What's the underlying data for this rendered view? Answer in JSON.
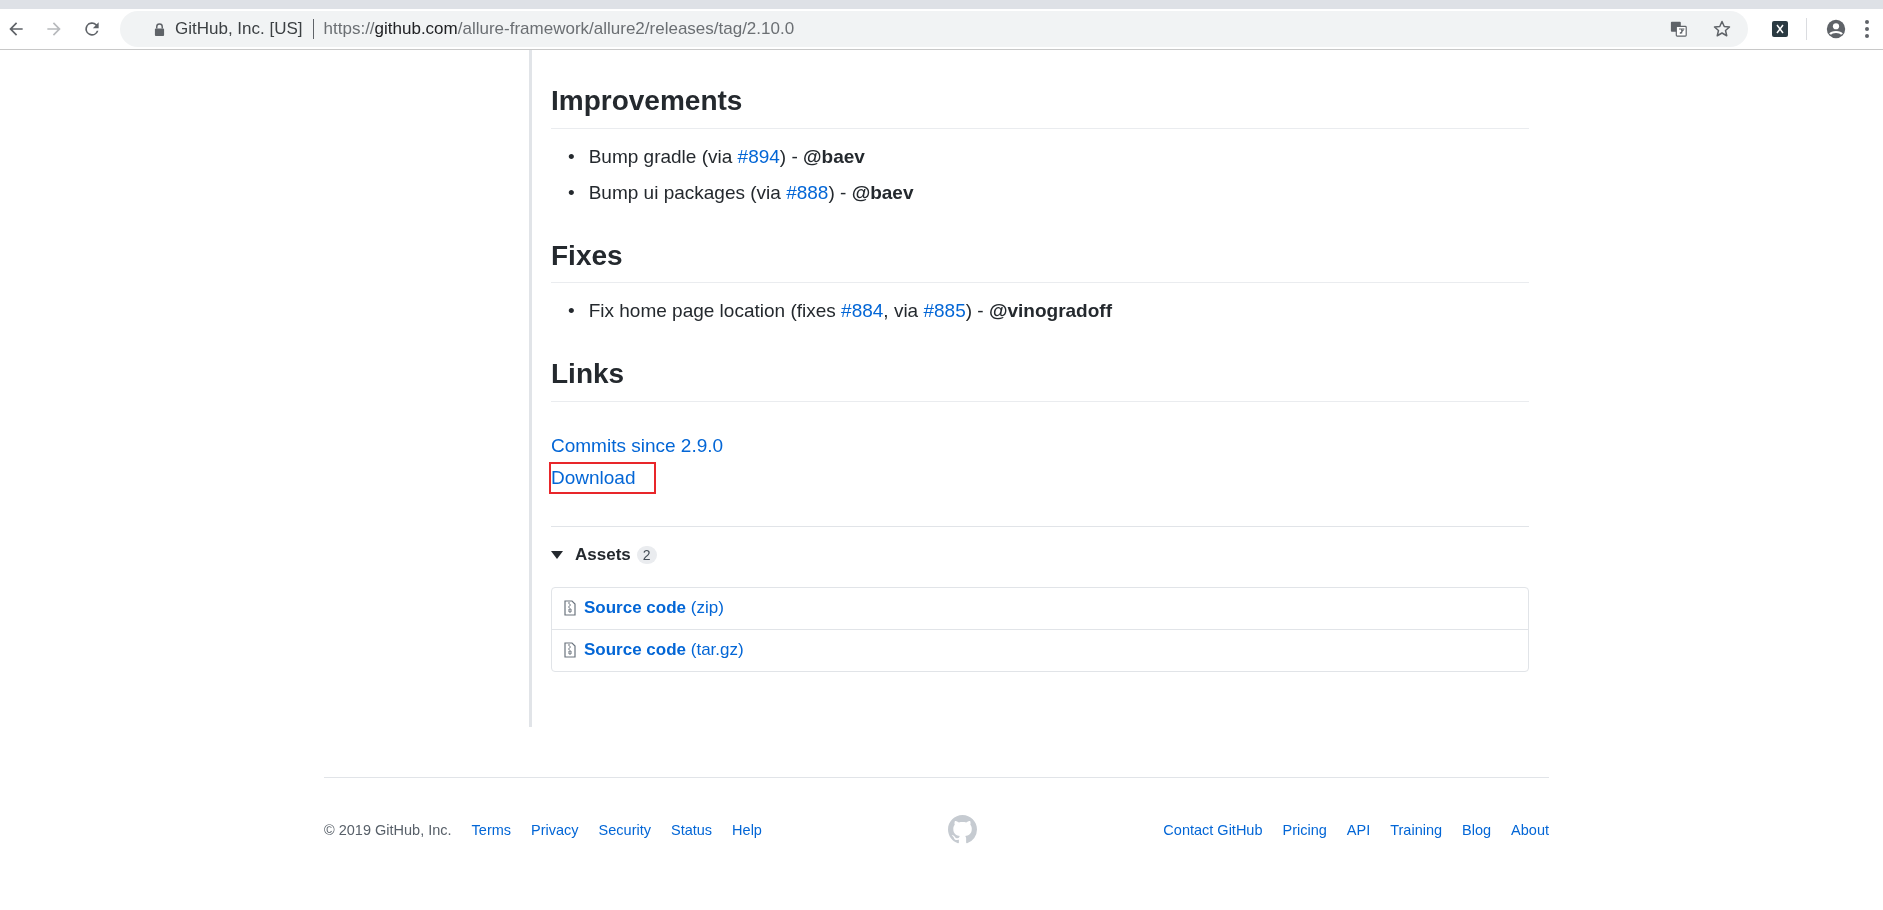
{
  "browser": {
    "site_label": "GitHub, Inc. [US]",
    "url_scheme": "https://",
    "url_host": "github.com",
    "url_path": "/allure-framework/allure2/releases/tag/2.10.0",
    "forward_disabled": true
  },
  "sections": [
    {
      "heading": "Improvements",
      "items": [
        {
          "marker": "•",
          "parts": [
            {
              "kind": "text",
              "text": "Bump gradle (via "
            },
            {
              "kind": "link",
              "text": "#894"
            },
            {
              "kind": "text",
              "text": ") - "
            },
            {
              "kind": "mention",
              "text": "@baev"
            }
          ]
        },
        {
          "marker": "•",
          "parts": [
            {
              "kind": "text",
              "text": "Bump ui packages (via "
            },
            {
              "kind": "link",
              "text": "#888"
            },
            {
              "kind": "text",
              "text": ") - "
            },
            {
              "kind": "mention",
              "text": "@baev"
            }
          ]
        }
      ]
    },
    {
      "heading": "Fixes",
      "items": [
        {
          "marker": "•",
          "parts": [
            {
              "kind": "text",
              "text": "Fix home page location (fixes "
            },
            {
              "kind": "link",
              "text": "#884"
            },
            {
              "kind": "text",
              "text": ", via "
            },
            {
              "kind": "link",
              "text": "#885"
            },
            {
              "kind": "text",
              "text": ") - "
            },
            {
              "kind": "mention",
              "text": "@vinogradoff"
            }
          ]
        }
      ]
    }
  ],
  "links": {
    "heading": "Links",
    "items": [
      {
        "label": "Commits since 2.9.0",
        "highlighted": false
      },
      {
        "label": "Download",
        "highlighted": true
      }
    ]
  },
  "assets": {
    "label": "Assets",
    "count": "2",
    "expanded": true,
    "items": [
      {
        "name": "Source code",
        "format": "(zip)"
      },
      {
        "name": "Source code",
        "format": "(tar.gz)"
      }
    ]
  },
  "footer": {
    "copyright": "© 2019 GitHub, Inc.",
    "left_links": [
      "Terms",
      "Privacy",
      "Security",
      "Status",
      "Help"
    ],
    "right_links": [
      "Contact GitHub",
      "Pricing",
      "API",
      "Training",
      "Blog",
      "About"
    ]
  }
}
